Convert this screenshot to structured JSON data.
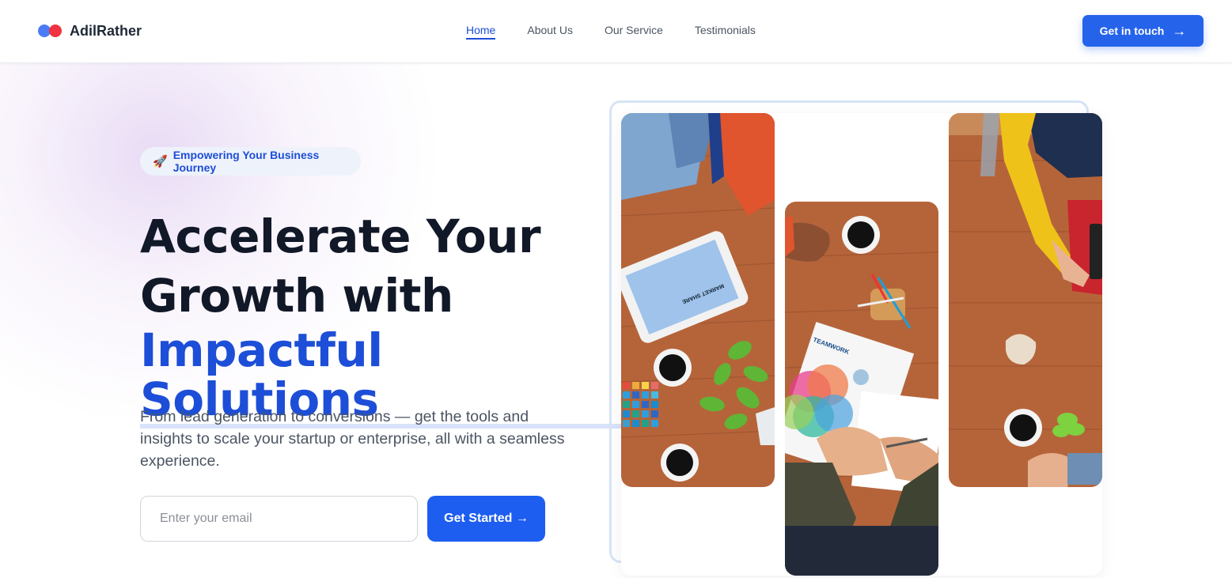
{
  "brand": {
    "name": "AdilRather"
  },
  "nav": {
    "links": [
      {
        "label": "Home",
        "active": true
      },
      {
        "label": "About Us",
        "active": false
      },
      {
        "label": "Our Service",
        "active": false
      },
      {
        "label": "Testimonials",
        "active": false
      }
    ],
    "cta_label": "Get in touch",
    "cta_icon": "arrow-right-icon"
  },
  "hero": {
    "badge": "Empowering Your Business Journey",
    "badge_icon": "rocket-icon",
    "headline_line1": "Accelerate Your",
    "headline_line2": "Growth with",
    "headline_accent": "Impactful Solutions",
    "subtext": "From lead generation to conversions — get the tools and insights to scale your startup or enterprise, all with a seamless experience.",
    "email_placeholder": "Enter your email",
    "submit_label": "Get Started →"
  },
  "gallery": {
    "photo_texts": {
      "tablet": "MARKET SHARE",
      "paper": "TEAMWORK"
    }
  },
  "colors": {
    "accent": "#1d4ed8",
    "button": "#2563eb",
    "logo_blue": "#4b7cf5",
    "logo_red": "#ef3340",
    "wood": "#b5643a"
  }
}
